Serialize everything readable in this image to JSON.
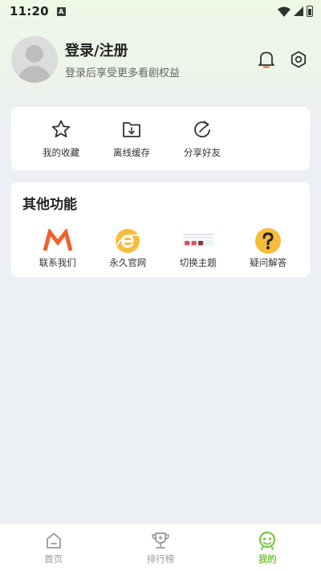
{
  "status_bar": {
    "time": "11:20",
    "notif_glyph": "A"
  },
  "profile": {
    "title": "登录/注册",
    "subtitle": "登录后享受更多看剧权益",
    "icons": [
      "bell-icon",
      "gear-icon"
    ]
  },
  "quick_actions": [
    {
      "label": "我的收藏",
      "icon": "star-icon"
    },
    {
      "label": "离线缓存",
      "icon": "download-folder-icon"
    },
    {
      "label": "分享好友",
      "icon": "share-refresh-icon"
    }
  ],
  "other": {
    "title": "其他功能",
    "items": [
      {
        "label": "联系我们",
        "icon": "m-logo-icon"
      },
      {
        "label": "永久官网",
        "icon": "browser-e-icon"
      },
      {
        "label": "切换主题",
        "icon": "theme-palette-icon"
      },
      {
        "label": "疑问解答",
        "icon": "question-icon"
      }
    ]
  },
  "tabs": [
    {
      "label": "首页",
      "icon": "home-icon",
      "active": false
    },
    {
      "label": "排行榜",
      "icon": "trophy-icon",
      "active": false
    },
    {
      "label": "我的",
      "icon": "profile-face-icon",
      "active": true
    }
  ],
  "colors": {
    "accent": "#7ac943",
    "orange": "#f0622f",
    "yellow": "#f6bd3b",
    "theme_red": "#e0505a"
  }
}
